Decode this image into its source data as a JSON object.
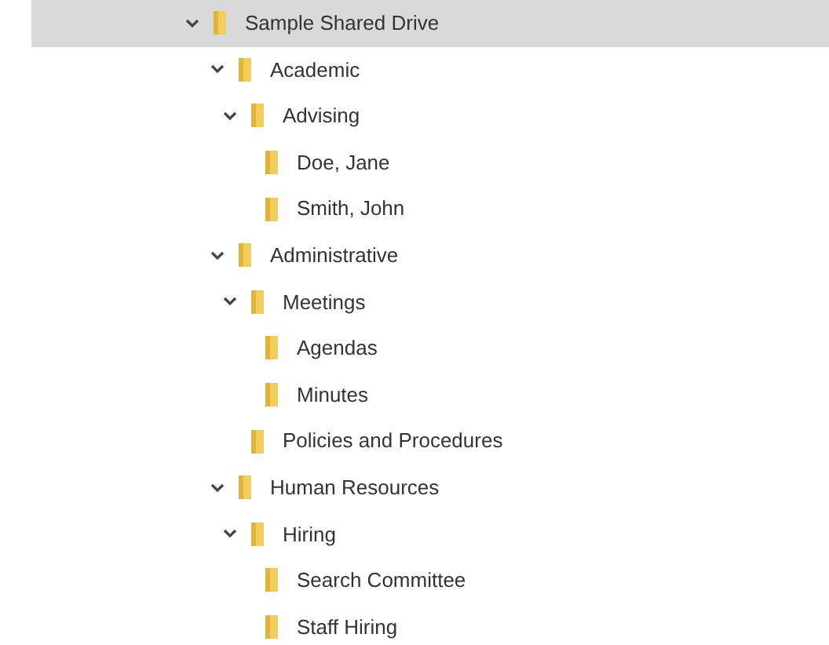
{
  "tree": [
    {
      "label": "Sample Shared Drive",
      "selected": true,
      "expanded": true,
      "children": [
        {
          "label": "Academic",
          "selected": false,
          "expanded": true,
          "children": [
            {
              "label": "Advising",
              "selected": false,
              "expanded": true,
              "children": [
                {
                  "label": "Doe, Jane",
                  "selected": false
                },
                {
                  "label": "Smith, John",
                  "selected": false
                }
              ]
            }
          ]
        },
        {
          "label": "Administrative",
          "selected": false,
          "expanded": true,
          "children": [
            {
              "label": "Meetings",
              "selected": false,
              "expanded": true,
              "children": [
                {
                  "label": "Agendas",
                  "selected": false
                },
                {
                  "label": "Minutes",
                  "selected": false
                }
              ]
            },
            {
              "label": "Policies and Procedures",
              "selected": false
            }
          ]
        },
        {
          "label": "Human Resources",
          "selected": false,
          "expanded": true,
          "children": [
            {
              "label": "Hiring",
              "selected": false,
              "expanded": true,
              "children": [
                {
                  "label": "Search Committee",
                  "selected": false
                },
                {
                  "label": "Staff Hiring",
                  "selected": false
                }
              ]
            }
          ]
        }
      ]
    }
  ]
}
